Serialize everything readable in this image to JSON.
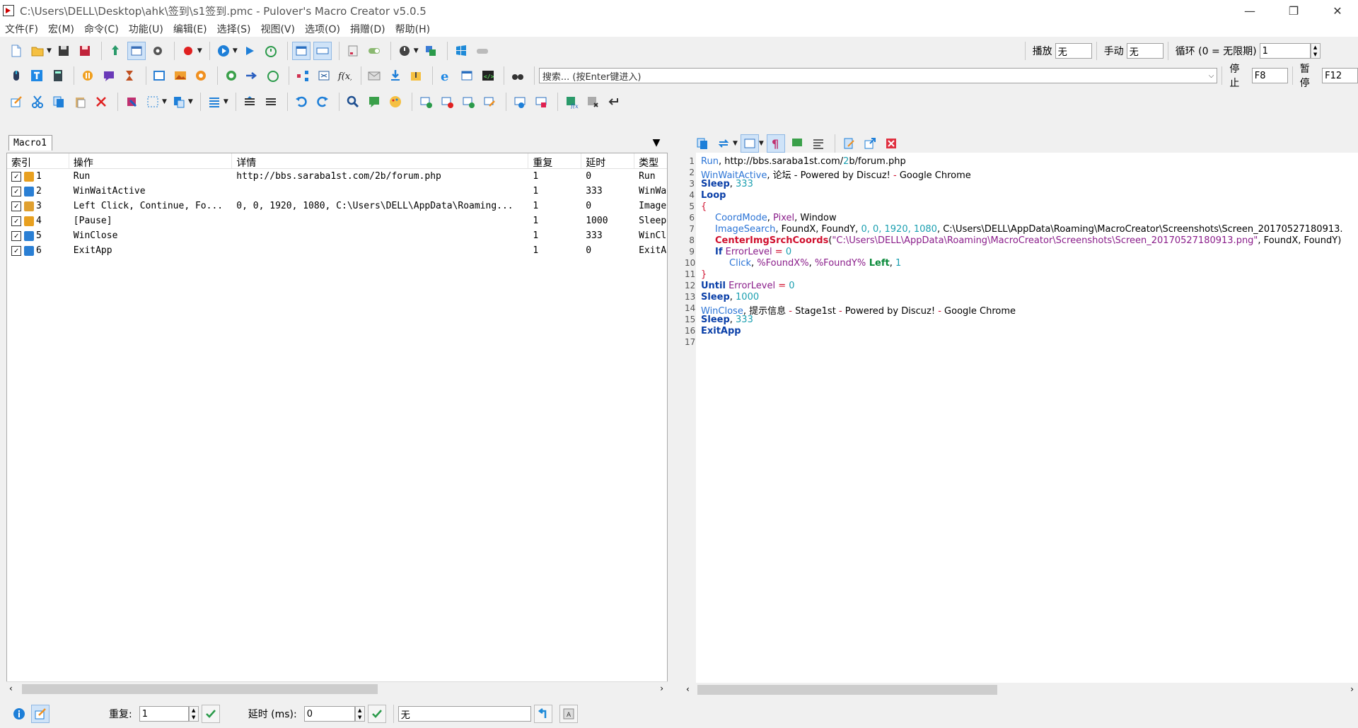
{
  "window": {
    "title": "C:\\Users\\DELL\\Desktop\\ahk\\签到\\s1签到.pmc - Pulover's Macro Creator v5.0.5",
    "minimize": "—",
    "restore": "❐",
    "close": "✕"
  },
  "menu": [
    "文件(F)",
    "宏(M)",
    "命令(C)",
    "功能(U)",
    "编辑(E)",
    "选择(S)",
    "视图(V)",
    "选项(O)",
    "捐赠(D)",
    "帮助(H)"
  ],
  "toolbar1": {
    "play_label": "播放",
    "play_value": "无",
    "manual_label": "手动",
    "manual_value": "无",
    "loop_label": "循环 (0 = 无限期)",
    "loop_value": "1"
  },
  "toolbar2": {
    "search_placeholder": "搜索... (按Enter键进入)",
    "stop_label": "停止",
    "stop_value": "F8",
    "pause_label": "暂停",
    "pause_value": "F12"
  },
  "tab": {
    "label": "Macro1"
  },
  "table": {
    "headers": [
      "索引",
      "操作",
      "详情",
      "重复",
      "延时",
      "类型"
    ],
    "rows": [
      {
        "index": "1",
        "action": "Run",
        "detail": "http://bbs.saraba1st.com/2b/forum.php",
        "repeat": "1",
        "delay": "0",
        "type": "Run",
        "icon": "gear-icon",
        "color": "#e8a020"
      },
      {
        "index": "2",
        "action": "WinWaitActive",
        "detail": "",
        "repeat": "1",
        "delay": "333",
        "type": "WinWa",
        "icon": "window-icon",
        "color": "#2a7fd4"
      },
      {
        "index": "3",
        "action": "Left Click, Continue, Fo...",
        "detail": "0, 0, 1920, 1080, C:\\Users\\DELL\\AppData\\Roaming...",
        "repeat": "1",
        "delay": "0",
        "type": "Image",
        "icon": "image-icon",
        "color": "#e0a030"
      },
      {
        "index": "4",
        "action": "[Pause]",
        "detail": "",
        "repeat": "1",
        "delay": "1000",
        "type": "Sleep",
        "icon": "pause-icon",
        "color": "#e8a020"
      },
      {
        "index": "5",
        "action": "WinClose",
        "detail": "",
        "repeat": "1",
        "delay": "333",
        "type": "WinCl",
        "icon": "window-icon",
        "color": "#2a7fd4"
      },
      {
        "index": "6",
        "action": "ExitApp",
        "detail": "",
        "repeat": "1",
        "delay": "0",
        "type": "ExitA",
        "icon": "exit-icon",
        "color": "#2a7fd4"
      }
    ]
  },
  "code": {
    "lines": [
      {
        "n": "1"
      },
      {
        "n": "2"
      },
      {
        "n": "3"
      },
      {
        "n": "4"
      },
      {
        "n": "5"
      },
      {
        "n": "6"
      },
      {
        "n": "7"
      },
      {
        "n": "8"
      },
      {
        "n": "9"
      },
      {
        "n": "10"
      },
      {
        "n": "11"
      },
      {
        "n": "12"
      },
      {
        "n": "13"
      },
      {
        "n": "14"
      },
      {
        "n": "15"
      },
      {
        "n": "16"
      },
      {
        "n": "17"
      }
    ],
    "l1": {
      "a": "Run",
      "b": ", http://bbs.saraba1st.com/",
      "c": "2",
      "d": "b/forum.php"
    },
    "l2": {
      "a": "WinWaitActive",
      "b": ", 论坛 - Powered by Discuz! ",
      "c": "-",
      "d": " Google Chrome"
    },
    "l3": {
      "a": "Sleep",
      "b": ", ",
      "c": "333"
    },
    "l4": {
      "a": "Loop"
    },
    "l5": {
      "a": "{"
    },
    "l6": {
      "a": "CoordMode",
      "b": ", ",
      "c": "Pixel",
      "d": ", Window"
    },
    "l7": {
      "a": "ImageSearch",
      "b": ", FoundX, FoundY, ",
      "c": "0, 0, 1920, 1080",
      "d": ", C:\\Users\\DELL\\AppData\\Roaming\\MacroCreator\\Screenshots\\Screen_20170527180913."
    },
    "l8": {
      "a": "CenterImgSrchCoords",
      "b": "(",
      "c": "\"C:\\Users\\DELL\\AppData\\Roaming\\MacroCreator\\Screenshots\\Screen_20170527180913.png\"",
      "d": ", FoundX, FoundY)"
    },
    "l9": {
      "a": "If",
      "b": " ",
      "c": "ErrorLevel",
      "d": " = ",
      "e": "0"
    },
    "l10": {
      "a": "Click",
      "b": ", ",
      "c": "%FoundX%",
      "d": ", ",
      "e": "%FoundY%",
      "f": " Left",
      "g": ", ",
      "h": "1"
    },
    "l11": {
      "a": "}"
    },
    "l12": {
      "a": "Until",
      "b": " ",
      "c": "ErrorLevel",
      "d": " = ",
      "e": "0"
    },
    "l13": {
      "a": "Sleep",
      "b": ", ",
      "c": "1000"
    },
    "l14": {
      "a": "WinClose",
      "b": ", 提示信息 ",
      "c": "-",
      "d": " Stage1st ",
      "e": "-",
      "f": " Powered by Discuz! ",
      "g": "-",
      "h": " Google Chrome"
    },
    "l15": {
      "a": "Sleep",
      "b": ", ",
      "c": "333"
    },
    "l16": {
      "a": "ExitApp"
    }
  },
  "bottom": {
    "repeat_label": "重复:",
    "repeat_value": "1",
    "delay_label": "延时 (ms):",
    "delay_value": "0",
    "window_value": "无"
  }
}
